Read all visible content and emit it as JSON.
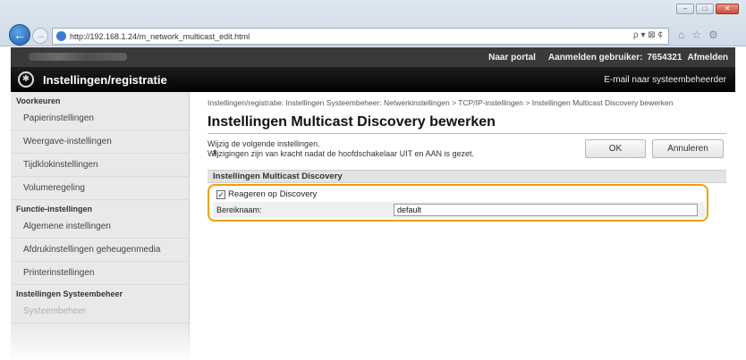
{
  "browser": {
    "url": "http://192.168.1.24/m_network_multicast_edit.html",
    "search_glyph": "ρ ▾ ⊠ ¢",
    "window_buttons": [
      "–",
      "□",
      "✕"
    ]
  },
  "topbar": {
    "portal": "Naar portal",
    "user_label": "Aanmelden gebruiker:",
    "user_id": "7654321",
    "logout": "Afmelden"
  },
  "header": {
    "title": "Instellingen/registratie",
    "mail": "E-mail naar systeembeheerder"
  },
  "sidebar": {
    "sections": [
      {
        "heading": "Voorkeuren",
        "items": [
          "Papierinstellingen",
          "Weergave-instellingen",
          "Tijdklokinstellingen",
          "Volumeregeling"
        ]
      },
      {
        "heading": "Functie-instellingen",
        "items": [
          "Algemene instellingen",
          "Afdrukinstellingen geheugenmedia",
          "Printerinstellingen"
        ]
      },
      {
        "heading": "Instellingen Systeembeheer",
        "items": [
          "Systeembeheer"
        ]
      }
    ]
  },
  "main": {
    "breadcrumb": "Instellingen/registratie: Instellingen Systeembeheer: Netwerkinstellingen > TCP/IP-instellingen > Instellingen Multicast Discovery bewerken",
    "title": "Instellingen Multicast Discovery bewerken",
    "instruction_1": "Wijzig de volgende instellingen.",
    "instruction_2": "Wijzigingen zijn van kracht nadat de hoofdschakelaar UIT en AAN is gezet.",
    "ok_label": "OK",
    "cancel_label": "Annuleren",
    "section_title": "Instellingen Multicast Discovery",
    "checkbox_label": "Reageren op Discovery",
    "checkbox_checked": true,
    "scope_label": "Bereiknaam:",
    "scope_value": "default",
    "highlight_color": "#f0a000"
  }
}
